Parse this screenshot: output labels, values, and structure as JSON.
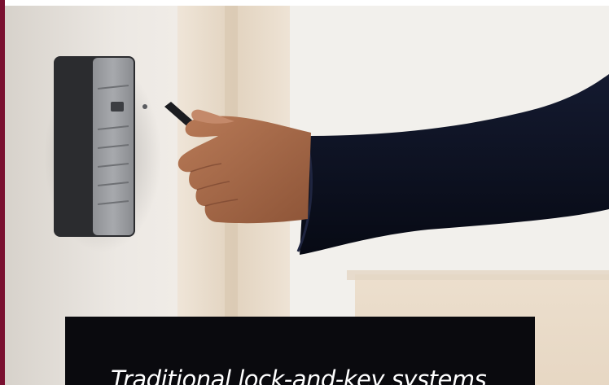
{
  "caption": {
    "text": "Traditional lock-and-key systems"
  },
  "photo": {
    "subject": "keycard-reader-photo",
    "card_reader_label": "",
    "accent_color": "#7a1030"
  },
  "colors": {
    "caption_bg": "#0a0a0e",
    "caption_text": "#ffffff",
    "wall": "#e9e4de",
    "sleeve": "#0d1326",
    "skin": "#a86d4c"
  }
}
